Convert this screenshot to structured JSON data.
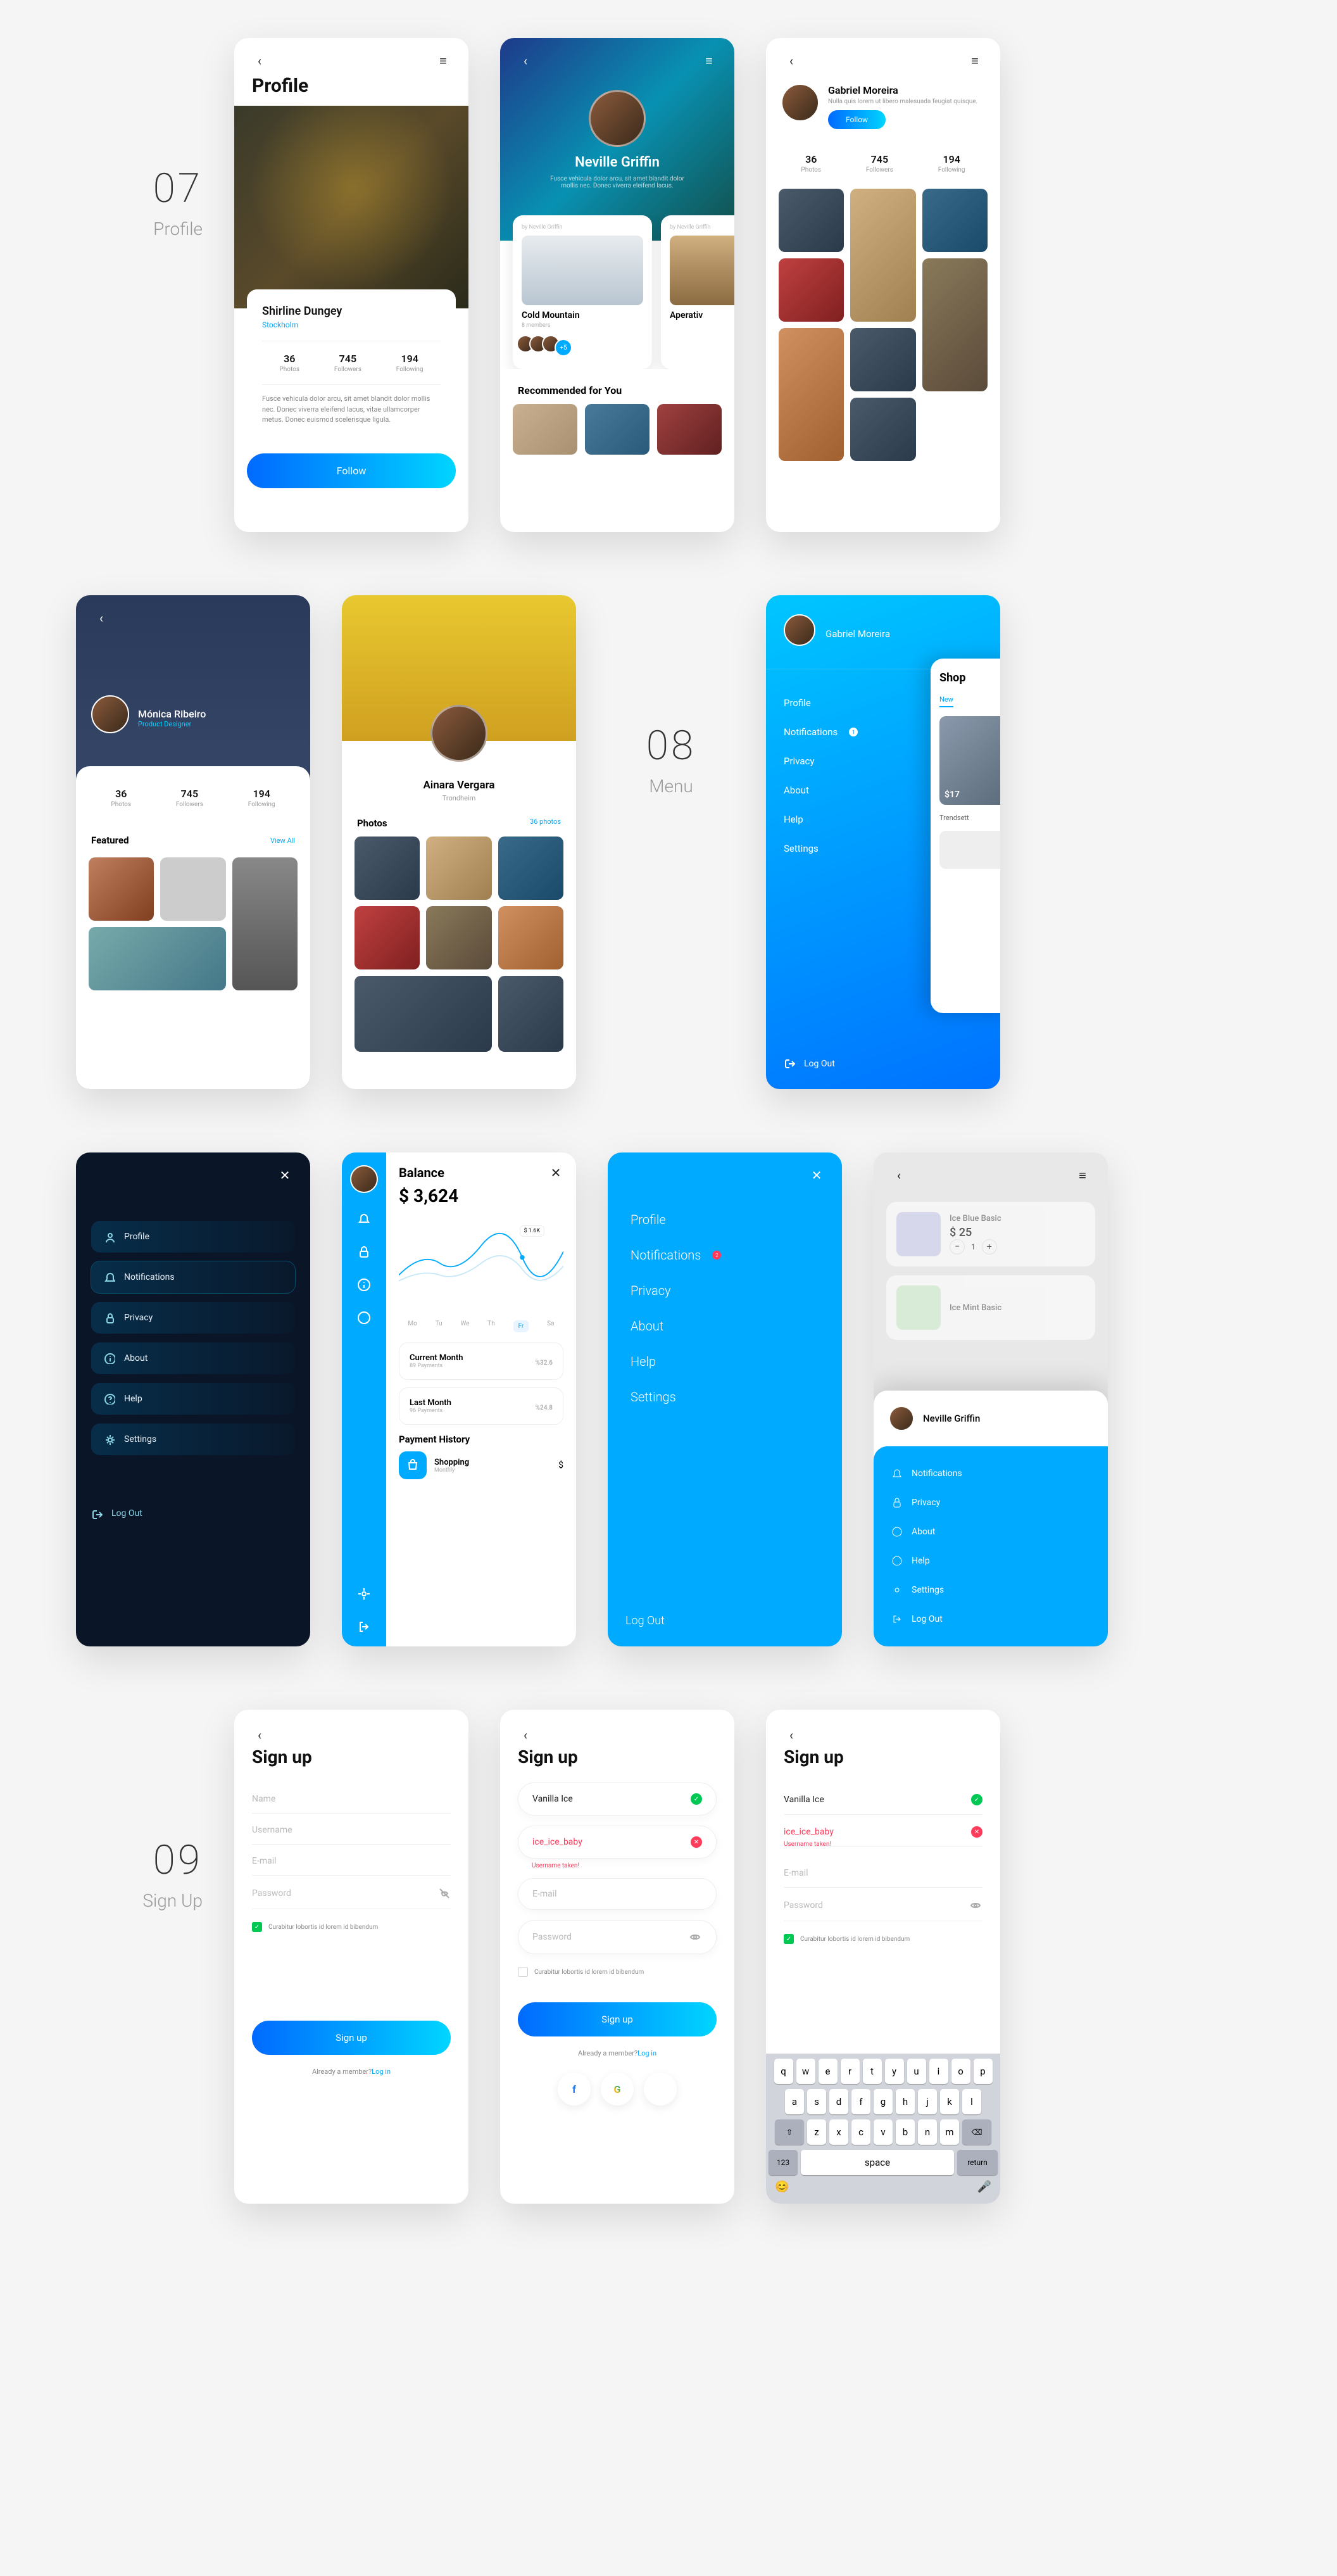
{
  "sections": {
    "s07": {
      "num": "07",
      "name": "Profile"
    },
    "s08": {
      "num": "08",
      "name": "Menu"
    },
    "s09": {
      "num": "09",
      "name": "Sign Up"
    }
  },
  "profile1": {
    "title": "Profile",
    "name": "Shirline Dungey",
    "location": "Stockholm",
    "stats": {
      "photos_n": "36",
      "photos_l": "Photos",
      "followers_n": "745",
      "followers_l": "Followers",
      "following_n": "194",
      "following_l": "Following"
    },
    "desc": "Fusce vehicula dolor arcu, sit amet blandit dolor mollis nec. Donec viverra eleifend lacus, vitae ullamcorper metus. Donec euismod scelerisque ligula.",
    "follow": "Follow"
  },
  "profile2": {
    "name": "Neville Griffin",
    "desc": "Fusce vehicula dolor arcu, sit amet blandit dolor mollis nec. Donec viverra eleifend lacus.",
    "card_by": "by Neville Griffin",
    "card_title": "Cold Mountain",
    "card_sub": "8 members",
    "card_more": "+5",
    "card2_title": "Aperativ",
    "rec_title": "Recommended for You"
  },
  "profile3": {
    "name": "Gabriel Moreira",
    "desc": "Nulla quis lorem ut libero malesuada feugiat quisque.",
    "follow": "Follow",
    "stats": {
      "photos_n": "36",
      "photos_l": "Photos",
      "followers_n": "745",
      "followers_l": "Followers",
      "following_n": "194",
      "following_l": "Following"
    }
  },
  "profile4": {
    "name": "Mónica Ribeiro",
    "role": "Product Designer",
    "stats": {
      "photos_n": "36",
      "photos_l": "Photos",
      "followers_n": "745",
      "followers_l": "Followers",
      "following_n": "194",
      "following_l": "Following"
    },
    "featured": "Featured",
    "viewall": "View All"
  },
  "profile5": {
    "name": "Ainara Vergara",
    "location": "Trondheim",
    "photos": "Photos",
    "count": "36 photos"
  },
  "menu1": {
    "name": "Gabriel Moreira",
    "items": [
      "Profile",
      "Notifications",
      "Privacy",
      "About",
      "Help",
      "Settings"
    ],
    "badge": "1",
    "logout": "Log Out",
    "peek_title": "Shop",
    "peek_tab": "New",
    "peek_price": "$17",
    "peek_item": "Trendsett"
  },
  "menu_dark": {
    "items": [
      "Profile",
      "Notifications",
      "Privacy",
      "About",
      "Help",
      "Settings"
    ],
    "logout": "Log Out"
  },
  "balance": {
    "title": "Balance",
    "amount": "$ 3,624",
    "peak": "$ 1.6K",
    "days": [
      "Mo",
      "Tu",
      "We",
      "Th",
      "Fr",
      "Sa"
    ],
    "current": "Current Month",
    "current_sub": "89 Payments",
    "current_val": "32.6",
    "last": "Last Month",
    "last_sub": "96 Payments",
    "last_val": "24.8",
    "history": "Payment History",
    "shopping": "Shopping",
    "shopping_sub": "Monthly"
  },
  "menu_blue2": {
    "items": [
      "Profile",
      "Notifications",
      "Privacy",
      "About",
      "Help",
      "Settings"
    ],
    "badge": "2",
    "logout": "Log Out"
  },
  "overlay": {
    "prod1": "Ice Blue Basic",
    "price1": "$ 25",
    "qty": "1",
    "prod2": "Ice Mint Basic",
    "name": "Neville Griffin",
    "items": [
      "Notifications",
      "Privacy",
      "About",
      "Help",
      "Settings",
      "Log Out"
    ]
  },
  "signup": {
    "title": "Sign up",
    "f_name": "Name",
    "f_username": "Username",
    "f_email": "E-mail",
    "f_password": "Password",
    "terms": "Curabitur lobortis id lorem id bibendum",
    "btn": "Sign up",
    "already": "Already a member?",
    "login": "Log in"
  },
  "signup2": {
    "name_val": "Vanilla Ice",
    "user_val": "ice_ice_baby",
    "user_err": "Username taken!"
  },
  "kbd": {
    "r1": [
      "q",
      "w",
      "e",
      "r",
      "t",
      "y",
      "u",
      "i",
      "o",
      "p"
    ],
    "r2": [
      "a",
      "s",
      "d",
      "f",
      "g",
      "h",
      "j",
      "k",
      "l"
    ],
    "r3": [
      "z",
      "x",
      "c",
      "v",
      "b",
      "n",
      "m"
    ],
    "num": "123",
    "space": "space",
    "ret": "return"
  }
}
